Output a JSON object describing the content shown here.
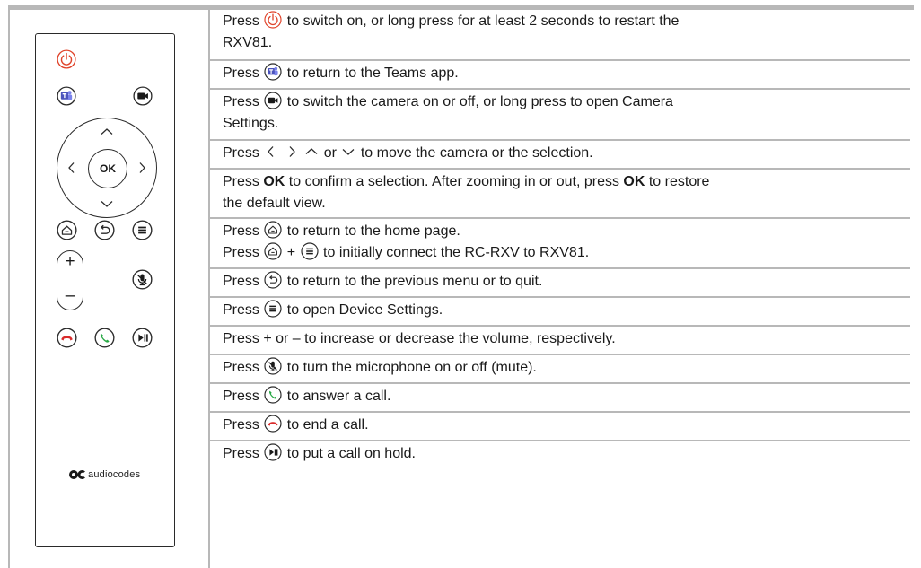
{
  "remote": {
    "ok_label": "OK",
    "volume_plus": "+",
    "volume_minus": "–",
    "brand": "audiocodes"
  },
  "rows": [
    {
      "lines": [
        {
          "a": "Press ",
          "b": " to switch on, or long press for at least 2 seconds to restart the"
        },
        {
          "a": "RXV81."
        }
      ]
    },
    {
      "lines": [
        {
          "a": "Press ",
          "b": " to return to the Teams app."
        }
      ]
    },
    {
      "lines": [
        {
          "a": "Press ",
          "b": " to switch the camera on or off, or long press to open Camera"
        },
        {
          "a": "Settings."
        }
      ]
    },
    {
      "lines": [
        {
          "a": "Press ",
          "b": " or ",
          "c": " to move the camera or the selection."
        }
      ]
    },
    {
      "lines": [
        {
          "a": "Press ",
          "bold1": "OK",
          "b": " to confirm a selection. After zooming in or out, press ",
          "bold2": "OK",
          "c": " to restore"
        },
        {
          "a": "the default view."
        }
      ]
    },
    {
      "lines": [
        {
          "a": "Press ",
          "b": " to return to the home page."
        },
        {
          "a": "Press ",
          "b": " + ",
          "c": " to initially connect the RC-RXV to RXV81."
        }
      ]
    },
    {
      "lines": [
        {
          "a": "Press ",
          "b": " to return to the previous menu or to quit."
        }
      ]
    },
    {
      "lines": [
        {
          "a": "Press ",
          "b": " to open Device Settings."
        }
      ]
    },
    {
      "lines": [
        {
          "a": "Press + or – to increase or decrease the volume, respectively."
        }
      ]
    },
    {
      "lines": [
        {
          "a": "Press ",
          "b": " to turn the microphone on or off (mute)."
        }
      ]
    },
    {
      "lines": [
        {
          "a": "Press ",
          "b": " to answer a call."
        }
      ]
    },
    {
      "lines": [
        {
          "a": "Press ",
          "b": " to end a call."
        }
      ]
    },
    {
      "lines": [
        {
          "a": "Press ",
          "b": " to put a call on hold."
        }
      ]
    }
  ],
  "colors": {
    "power_red": "#e0432a",
    "teams_blue": "#4b53bc",
    "answer_green": "#27a844",
    "end_red": "#d92b2b",
    "border_gray": "#b8b8b8"
  },
  "icons": [
    "power-icon",
    "teams-icon",
    "camera-icon",
    "arrow-left-icon",
    "arrow-right-icon",
    "arrow-up-icon",
    "arrow-down-icon",
    "home-icon",
    "back-icon",
    "menu-icon",
    "mute-icon",
    "answer-call-icon",
    "end-call-icon",
    "hold-icon",
    "audiocodes-logo"
  ]
}
